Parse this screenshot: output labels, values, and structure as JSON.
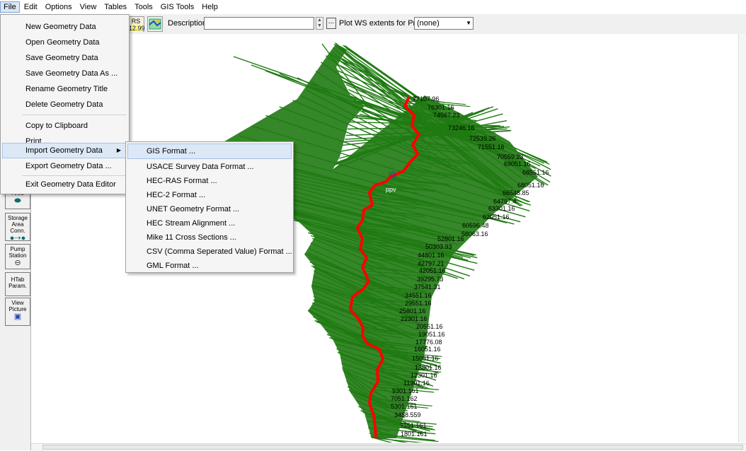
{
  "menubar": [
    "File",
    "Edit",
    "Options",
    "View",
    "Tables",
    "Tools",
    "GIS Tools",
    "Help"
  ],
  "toolbar": {
    "rs_label": "RS",
    "rs_value": "12.99",
    "description_label": "Description :",
    "description_value": "",
    "plot_label": "Plot WS extents for Profile:",
    "profile_value": "(none)",
    "dots_label": "..."
  },
  "file_menu": {
    "items": [
      "New Geometry Data",
      "Open Geometry Data",
      "Save Geometry Data",
      "Save Geometry Data As ...",
      "Rename Geometry Title",
      "Delete Geometry Data",
      "Copy to Clipboard",
      "Print ...",
      "Import Geometry Data",
      "Export Geometry Data ...",
      "Exit Geometry Data Editor"
    ],
    "highlighted": "Import Geometry Data"
  },
  "import_menu": {
    "items": [
      "GIS Format ...",
      "USACE Survey Data Format ...",
      "HEC-RAS Format ...",
      "HEC-2 Format ...",
      "UNET Geometry Format ...",
      "HEC Stream Alignment ...",
      "Mike 11 Cross Sections ...",
      "CSV (Comma Seperated Value) Format ...",
      "GML Format ..."
    ],
    "highlighted": "GIS Format ..."
  },
  "left_tools": {
    "area": "Area",
    "storage_area_conn": [
      "Storage",
      "Area Conn."
    ],
    "pump_station": [
      "Pump",
      "Station"
    ],
    "htab_param": [
      "HTab",
      "Param."
    ],
    "view_picture": [
      "View",
      "Picture"
    ]
  },
  "map": {
    "river_label": "ppv",
    "stations": [
      "77107.96",
      "76301.16",
      "74567.23",
      "73246.16",
      "72539.26",
      "71551.16",
      "70559.23",
      "69051.16",
      "68551.16",
      "68051.16",
      "66548.85",
      "64797.4",
      "63301.16",
      "62051.16",
      "60596.48",
      "58063.16",
      "52801.16",
      "50303.93",
      "44801.16",
      "42797.21",
      "42051.16",
      "39295.73",
      "37541.31",
      "34551.16",
      "29551.16",
      "25801.16",
      "22301.16",
      "20551.16",
      "19051.16",
      "17776.08",
      "16051.16",
      "15051.16",
      "13801.16",
      "12301.16",
      "11301.16",
      "9301.161",
      "7051.162",
      "5301.161",
      "3458.559",
      "2551.161",
      "1801.161"
    ]
  },
  "colors": {
    "cross_section": "#1f7a12",
    "river": "#ff0000",
    "menu_highlight": "#dde8f6"
  }
}
